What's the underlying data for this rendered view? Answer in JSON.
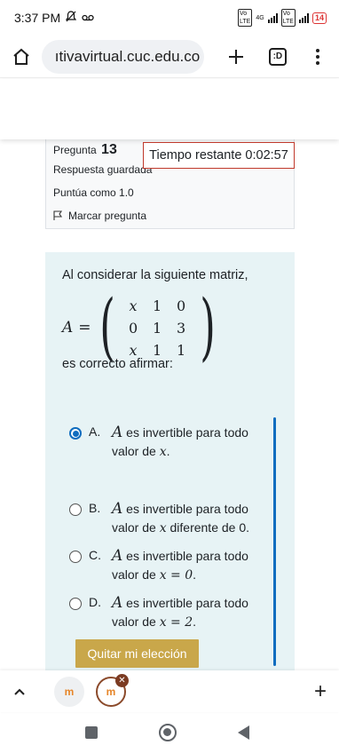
{
  "status_bar": {
    "time": "3:37 PM",
    "icons": [
      "mute-icon",
      "voicemail-icon",
      "volte-icon",
      "signal-icon",
      "battery-icon"
    ],
    "network_label": "4G",
    "battery": "14"
  },
  "browser": {
    "url": "ıtivavirtual.cuc.edu.co",
    "tabs_label": ":D"
  },
  "question_info": {
    "label": "Pregunta",
    "number": "13",
    "state": "Respuesta guardada",
    "grade": "Puntúa como 1.0",
    "flag_label": "Marcar pregunta"
  },
  "timer": "Tiempo restante 0:02:57",
  "question": {
    "intro": "Al considerar la siguiente matriz,",
    "matrix_name": "A",
    "matrix": [
      [
        "x",
        "1",
        "0"
      ],
      [
        "0",
        "1",
        "3"
      ],
      [
        "x",
        "1",
        "1"
      ]
    ],
    "prompt": "es correcto afirmar:"
  },
  "options": [
    {
      "letter": "A.",
      "m": "A",
      "line1": " es invertible para todo",
      "line2a": "valor de ",
      "mv": "x",
      "line2b": ".",
      "selected": true
    },
    {
      "letter": "B.",
      "m": "A",
      "line1": " es invertible para todo",
      "line2a": "valor de ",
      "mv": "x",
      "line2b": " diferente de 0.",
      "selected": false
    },
    {
      "letter": "C.",
      "m": "A",
      "line1": " es invertible para todo",
      "line2a": "valor de ",
      "mv": "x = 0",
      "line2b": ".",
      "selected": false
    },
    {
      "letter": "D.",
      "m": "A",
      "line1": " es invertible para todo",
      "line2a": "valor de ",
      "mv": "x = 2",
      "line2b": ".",
      "selected": false
    }
  ],
  "clear_button": "Quitar mi elección",
  "bottom_tabs": {
    "favicon_label": "m"
  },
  "colors": {
    "accent": "#0f6cbf",
    "clear_button": "#c9a74a",
    "timer_border": "#c0392b",
    "question_bg": "#e7f3f5"
  }
}
